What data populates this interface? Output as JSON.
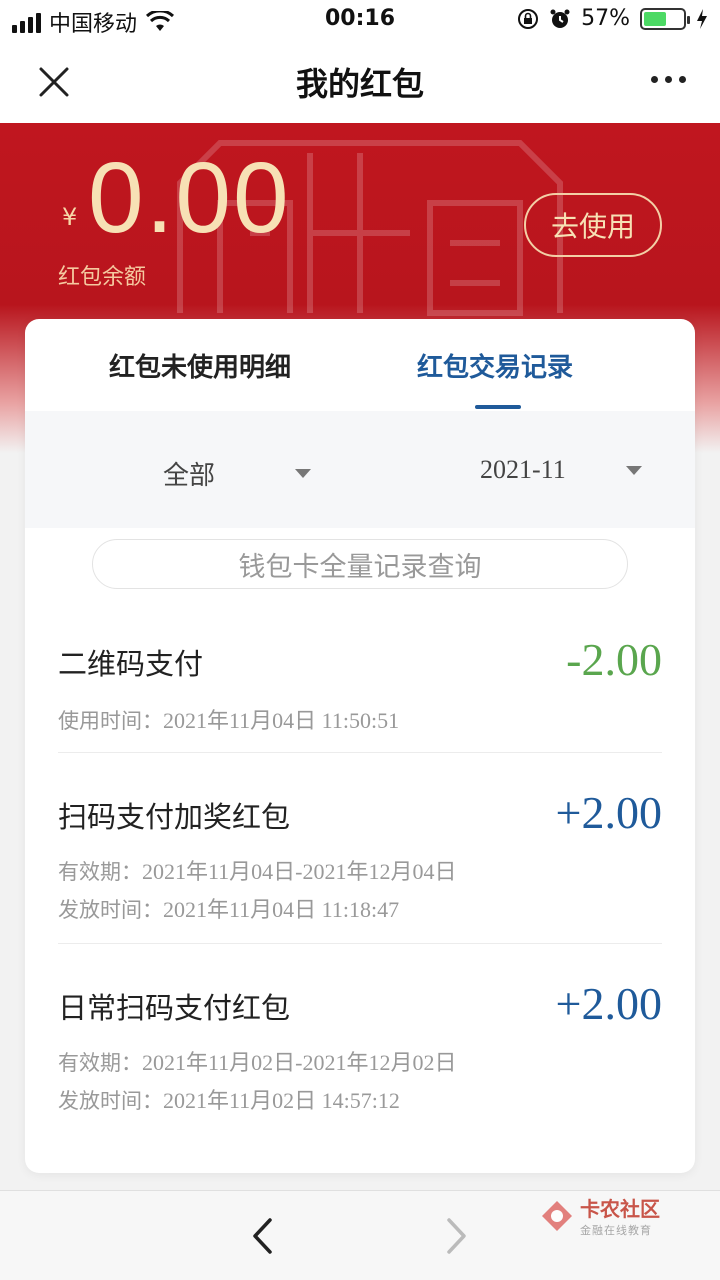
{
  "status_bar": {
    "carrier": "中国移动",
    "time": "00:16",
    "battery_percent": "57%",
    "battery_level": 0.57
  },
  "nav": {
    "title": "我的红包",
    "close_icon": "close-icon",
    "more_icon": "more-icon"
  },
  "header": {
    "currency_symbol": "¥",
    "balance": "0.00",
    "balance_label": "红包余额",
    "use_button": "去使用"
  },
  "tabs": [
    {
      "label": "红包未使用明细",
      "active": false
    },
    {
      "label": "红包交易记录",
      "active": true
    }
  ],
  "filters": {
    "type": "全部",
    "month": "2021-11"
  },
  "query_button": "钱包卡全量记录查询",
  "records": [
    {
      "title": "二维码支付",
      "amount": "-2.00",
      "amount_color": "#5aa64e",
      "lines": [
        {
          "label": "使用时间：",
          "value": "2021年11月04日 11:50:51"
        }
      ]
    },
    {
      "title": "扫码支付加奖红包",
      "amount": "+2.00",
      "amount_color": "#1f5a9a",
      "lines": [
        {
          "label": "有效期：",
          "value": "2021年11月04日-2021年12月04日"
        },
        {
          "label": "发放时间：",
          "value": "2021年11月04日 11:18:47"
        }
      ]
    },
    {
      "title": "日常扫码支付红包",
      "amount": "+2.00",
      "amount_color": "#1f5a9a",
      "lines": [
        {
          "label": "有效期：",
          "value": "2021年11月02日-2021年12月02日"
        },
        {
          "label": "发放时间：",
          "value": "2021年11月02日 14:57:12"
        }
      ]
    }
  ],
  "watermark": {
    "name": "卡农社区",
    "subtitle": "金融在线教育"
  },
  "colors": {
    "brand_red": "#c0161f",
    "accent_blue": "#1f5a9a",
    "gold": "#f7e1b5"
  }
}
